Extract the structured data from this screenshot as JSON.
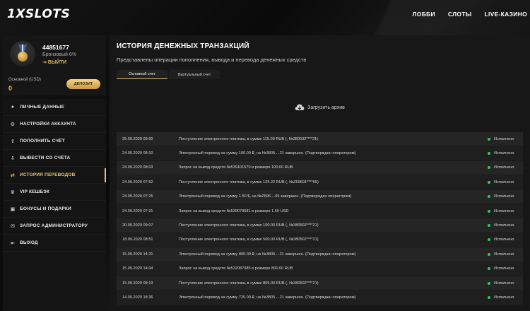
{
  "header": {
    "logo": "1XSLOTS",
    "nav": [
      "ЛОББИ",
      "СЛОТЫ",
      "LIVE-КАЗИНО"
    ]
  },
  "profile": {
    "id": "44851677",
    "tier": "Бронзовый 6%",
    "logout": "ВЫЙТИ",
    "balance_label": "Основной (USD)",
    "balance": "0",
    "deposit_button": "ДЕПОЗИТ"
  },
  "menu": [
    {
      "label": "ЛИЧНЫЕ ДАННЫЕ",
      "icon": "user-icon"
    },
    {
      "label": "НАСТРОЙКИ АККАУНТА",
      "icon": "gears-icon"
    },
    {
      "label": "ПОПОЛНИТЬ СЧЁТ",
      "icon": "upload-icon"
    },
    {
      "label": "ВЫВЕСТИ СО СЧЁТА",
      "icon": "download-icon"
    },
    {
      "label": "ИСТОРИЯ ПЕРЕВОДОВ",
      "icon": "transfer-icon",
      "active": true
    },
    {
      "label": "VIP КЕШБЭК",
      "icon": "crown-icon"
    },
    {
      "label": "БОНУСЫ И ПОДАРКИ",
      "icon": "gift-icon"
    },
    {
      "label": "ЗАПРОС АДМИНИСТРАТОРУ",
      "icon": "mail-icon"
    },
    {
      "label": "ВЫХОД",
      "icon": "exit-icon"
    }
  ],
  "main": {
    "title": "ИСТОРИЯ ДЕНЕЖНЫХ ТРАНЗАКЦИЙ",
    "subtitle": "Представлены операции пополнения, вывода и перевода денежных средств",
    "tabs": [
      "Основной счет",
      "Виртуальный счет"
    ],
    "archive": "Загрузить архив",
    "rows": [
      {
        "date": "25.09.2020 09:00",
        "desc": "Поступление электронного платежа, в сумме 115.00 RUB (, №380502****21)",
        "status": "Исполнено"
      },
      {
        "date": "24.09.2020 08:10",
        "desc": "Электронный перевод на сумму 100.00 ₽, на №3805....21 завершен. (Подтвержден оператором)",
        "status": "Исполнено"
      },
      {
        "date": "24.09.2020 08:03",
        "desc": "Запрос на вывод средств №539101579 в размере 100.00 RUB",
        "status": "Исполнено"
      },
      {
        "date": "24.09.2020 07:52",
        "desc": "Поступление электронного платежа, в сумме 125.22 RUB (, №Z69691****65)",
        "status": "Исполнено"
      },
      {
        "date": "24.09.2020 07:25",
        "desc": "Электронный перевод на сумму 1.50 $, на №Z696....65 завершен. (Подтвержден оператором)",
        "status": "Исполнено"
      },
      {
        "date": "24.09.2020 07:21",
        "desc": "Запрос на вывод средств №539079581 в размере 1.50 USD",
        "status": "Исполнено"
      },
      {
        "date": "20.09.2020 09:07",
        "desc": "Поступление электронного платежа, в сумме 100.00 RUB (, №380502****21)",
        "status": "Исполнено"
      },
      {
        "date": "18.09.2020 08:51",
        "desc": "Поступление электронного платежа, в сумме 500.00 RUB (, №380502****21)",
        "status": "Исполнено"
      },
      {
        "date": "15.09.2020 14:21",
        "desc": "Электронный перевод на сумму 800.00 ₽, на №3805....21 завершен. (Подтвержден оператором)",
        "status": "Исполнено"
      },
      {
        "date": "15.09.2020 14:04",
        "desc": "Запрос на вывод средств №532087085 в размере 800.00 RUB",
        "status": "Исполнено"
      },
      {
        "date": "15.09.2020 08:13",
        "desc": "Поступление электронного платежа, в сумме 805.00 RUB (, №380502****21)",
        "status": "Исполнено"
      },
      {
        "date": "14.09.2020 18:36",
        "desc": "Электронный перевод на сумму 720.00 ₽, на №3805....21 завершен. (Подтвержден оператором)",
        "status": "Исполнено"
      }
    ]
  },
  "colors": {
    "accent": "#e6c16a",
    "status_ok": "#36c26a"
  }
}
